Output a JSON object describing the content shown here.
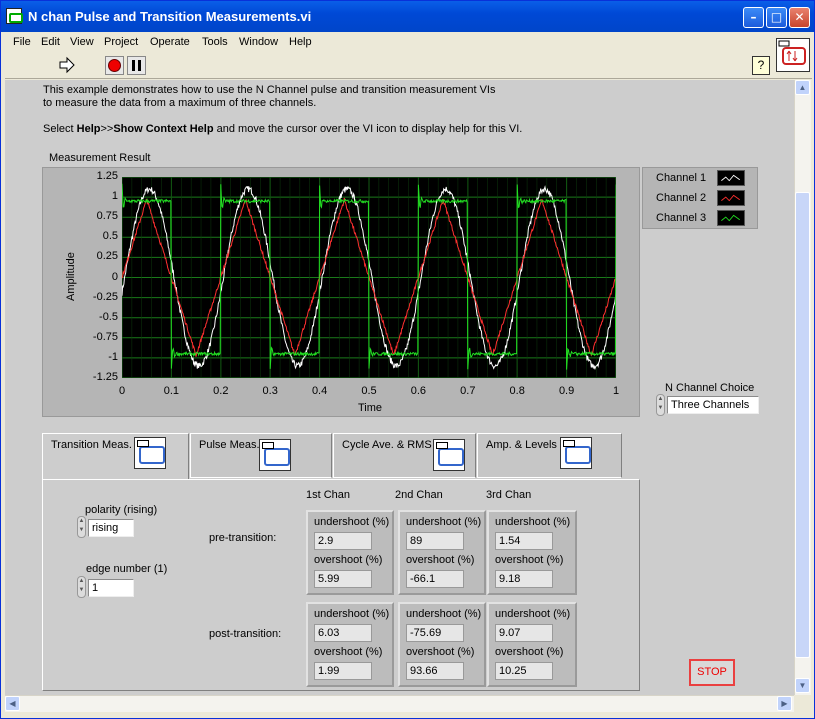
{
  "window": {
    "title": "N chan Pulse and Transition Measurements.vi",
    "buttons": {
      "minimize": "–",
      "maximize": "□",
      "close": "✕"
    }
  },
  "menu": [
    "File",
    "Edit",
    "View",
    "Project",
    "Operate",
    "Tools",
    "Window",
    "Help"
  ],
  "toolbar": {
    "help": "?"
  },
  "description": {
    "line1": "This example demonstrates how to use the N Channel pulse and transition measurement VIs",
    "line2": "to measure the data from a maximum of three channels.",
    "line3_pre": "Select ",
    "line3_bold1": "Help",
    "line3_mid": ">>",
    "line3_bold2": "Show Context Help",
    "line3_post": " and move the cursor over the VI icon to display help for this VI."
  },
  "graph": {
    "label": "Measurement Result",
    "xlabel": "Time",
    "ylabel": "Amplitude"
  },
  "chart_data": {
    "type": "line",
    "title": "Measurement Result",
    "xlabel": "Time",
    "ylabel": "Amplitude",
    "xlim": [
      0,
      1
    ],
    "ylim": [
      -1.25,
      1.25
    ],
    "xticks": [
      "0",
      "0.1",
      "0.2",
      "0.3",
      "0.4",
      "0.5",
      "0.6",
      "0.7",
      "0.8",
      "0.9",
      "1"
    ],
    "yticks": [
      "1.25",
      "1",
      "0.75",
      "0.5",
      "0.25",
      "0",
      "-0.25",
      "-0.5",
      "-0.75",
      "-1",
      "-1.25"
    ],
    "grid": true,
    "legend": "right",
    "series": [
      {
        "name": "Channel 1",
        "color": "#ffffff",
        "shape": "noisy sine",
        "frequency": 5,
        "amplitude": 1.1,
        "phase_deg": -10
      },
      {
        "name": "Channel 2",
        "color": "#ff3030",
        "shape": "triangle",
        "frequency": 5,
        "amplitude": 0.97,
        "offset": 0
      },
      {
        "name": "Channel 3",
        "color": "#22dd22",
        "shape": "square with ringing",
        "frequency": 5,
        "amplitude": 0.95
      }
    ]
  },
  "legend": [
    {
      "label": "Channel 1",
      "color": "#ffffff"
    },
    {
      "label": "Channel 2",
      "color": "#ff3030"
    },
    {
      "label": "Channel 3",
      "color": "#22dd22"
    }
  ],
  "nchannel": {
    "label": "N Channel Choice",
    "value": "Three Channels"
  },
  "tabs": [
    {
      "label": "Transition Meas."
    },
    {
      "label": "Pulse Meas."
    },
    {
      "label": "Cycle Ave. & RMS"
    },
    {
      "label": "Amp. & Levels"
    }
  ],
  "polarity": {
    "label": "polarity (rising)",
    "value": "rising"
  },
  "edge": {
    "label": "edge number (1)",
    "value": "1"
  },
  "columns": [
    "1st Chan",
    "2nd Chan",
    "3rd Chan"
  ],
  "rows": {
    "pre": "pre-transition:",
    "post": "post-transition:"
  },
  "undershoot_label": "undershoot (%)",
  "overshoot_label": "overshoot (%)",
  "pre": [
    {
      "undershoot": "2.9",
      "overshoot": "5.99"
    },
    {
      "undershoot": "89",
      "overshoot": "-66.1"
    },
    {
      "undershoot": "1.54",
      "overshoot": "9.18"
    }
  ],
  "post": [
    {
      "undershoot": "6.03",
      "overshoot": "1.99"
    },
    {
      "undershoot": "-75.69",
      "overshoot": "93.66"
    },
    {
      "undershoot": "9.07",
      "overshoot": "10.25"
    }
  ],
  "stop": "STOP"
}
